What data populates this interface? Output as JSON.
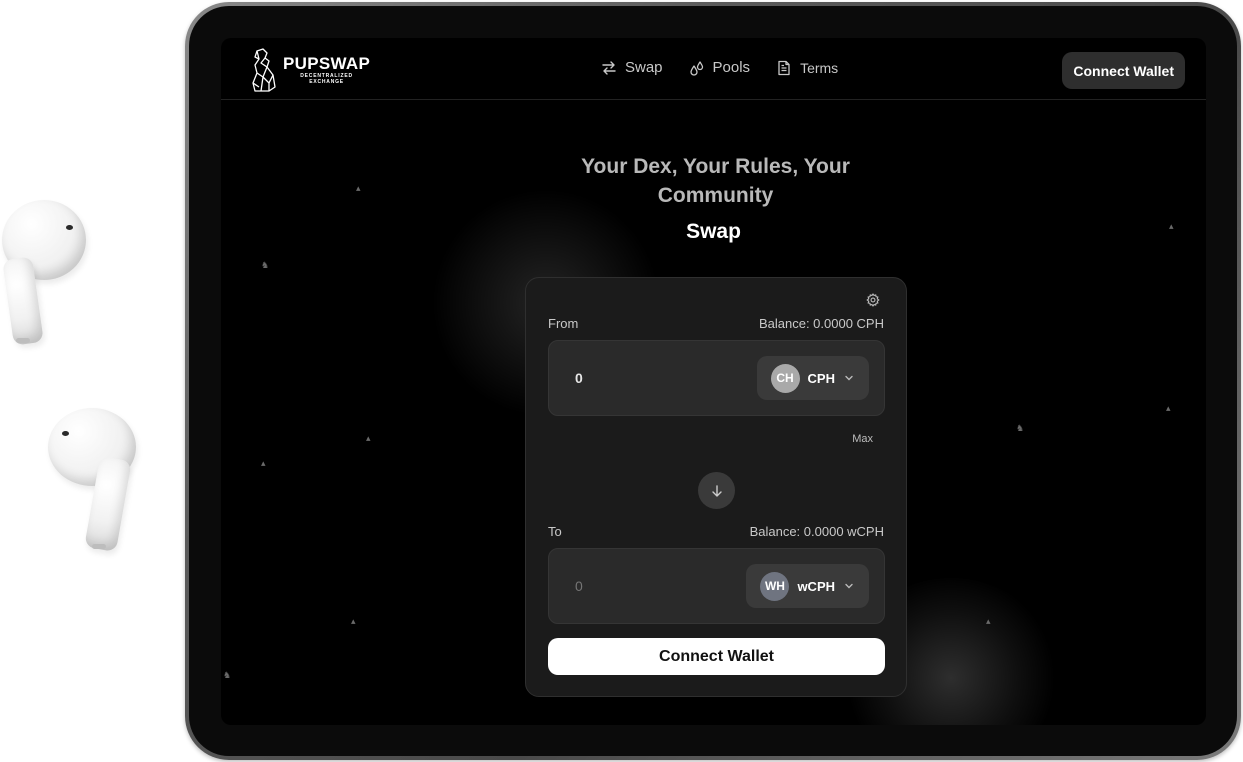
{
  "header": {
    "logo_title": "PUPSWAP",
    "logo_subtitle_line1": "DECENTRALIZED",
    "logo_subtitle_line2": "EXCHANGE",
    "nav": [
      {
        "label": "Swap",
        "icon": "swap-arrows-icon"
      },
      {
        "label": "Pools",
        "icon": "droplets-icon"
      },
      {
        "label": "Terms",
        "icon": "document-icon"
      }
    ],
    "connect_wallet_label": "Connect Wallet"
  },
  "hero": {
    "tagline": "Your Dex, Your Rules, Your Community",
    "title": "Swap"
  },
  "swap_card": {
    "settings_icon": "gear-icon",
    "from": {
      "label": "From",
      "balance": "Balance: 0.0000 CPH",
      "amount": "0",
      "token_avatar": "CH",
      "token_symbol": "CPH"
    },
    "max_label": "Max",
    "switch_icon": "arrow-down-icon",
    "to": {
      "label": "To",
      "balance": "Balance: 0.0000 wCPH",
      "amount_placeholder": "0",
      "token_avatar": "WH",
      "token_symbol": "wCPH"
    },
    "connect_wallet_label": "Connect Wallet"
  },
  "colors": {
    "background": "#000000",
    "card": "#1b1b1b",
    "input": "#2a2a2a",
    "primary_button": "#ffffff",
    "cph_avatar": "#a9a9a9",
    "wcph_avatar": "#6f7480"
  }
}
